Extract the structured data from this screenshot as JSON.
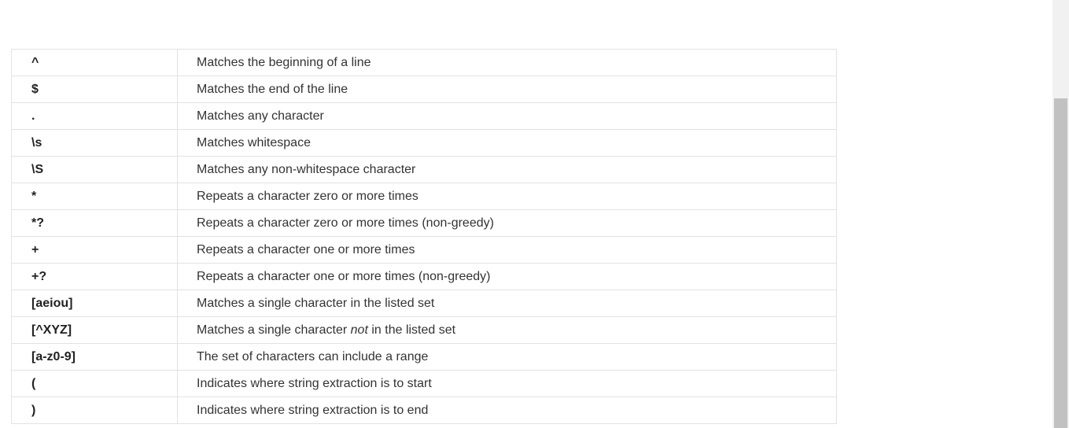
{
  "regex_table": {
    "rows": [
      {
        "pattern": "^",
        "desc": "Matches the beginning of a line"
      },
      {
        "pattern": "$",
        "desc": "Matches the end of the line"
      },
      {
        "pattern": ".",
        "desc": "Matches any character"
      },
      {
        "pattern": "\\s",
        "desc": "Matches whitespace"
      },
      {
        "pattern": "\\S",
        "desc": "Matches any non-whitespace character"
      },
      {
        "pattern": "*",
        "desc": "Repeats a character zero or more times"
      },
      {
        "pattern": "*?",
        "desc": "Repeats a character zero or more times (non-greedy)"
      },
      {
        "pattern": "+",
        "desc": "Repeats a character one or more times"
      },
      {
        "pattern": "+?",
        "desc": "Repeats a character one or more times (non-greedy)"
      },
      {
        "pattern": "[aeiou]",
        "desc": "Matches a single character in the listed set"
      },
      {
        "pattern": "[^XYZ]",
        "desc_before": "Matches a single character ",
        "desc_em": "not",
        "desc_after": " in the listed set"
      },
      {
        "pattern": "[a-z0-9]",
        "desc": "The set of characters can include a range"
      },
      {
        "pattern": "(",
        "desc": "Indicates where string extraction is to start"
      },
      {
        "pattern": ")",
        "desc": "Indicates where string extraction is to end"
      }
    ]
  }
}
